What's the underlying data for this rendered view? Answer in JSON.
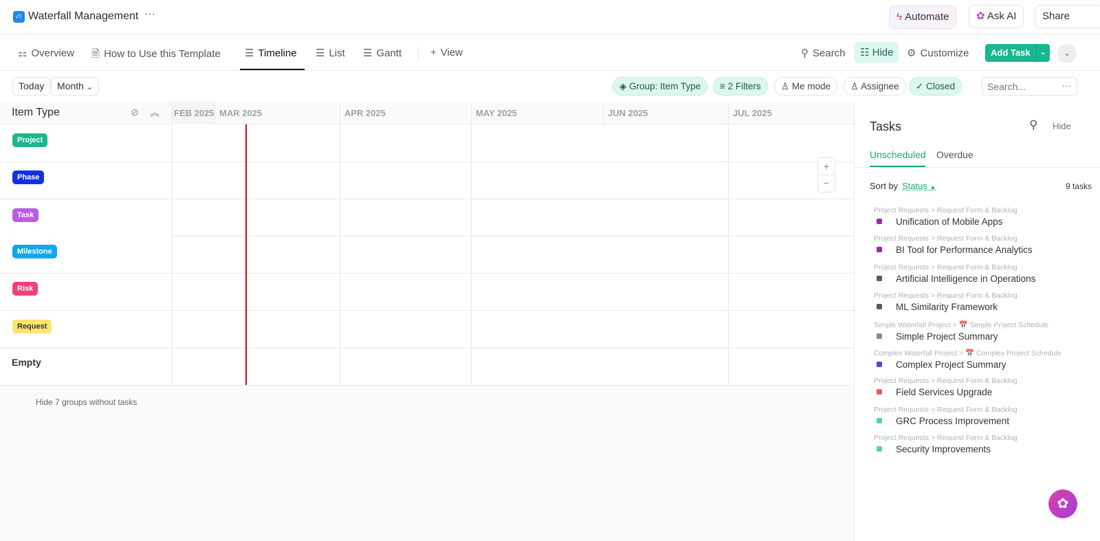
{
  "header": {
    "title": "Waterfall Management",
    "more": "···",
    "automate": "Automate",
    "ask_ai": "Ask AI",
    "share": "Share"
  },
  "tabs": [
    {
      "label": "Overview",
      "icon": "⚏"
    },
    {
      "label": "How to Use this Template",
      "icon": "🗎"
    },
    {
      "label": "Timeline",
      "icon": "☰"
    },
    {
      "label": "List",
      "icon": "☰"
    },
    {
      "label": "Gantt",
      "icon": "☰"
    },
    {
      "label": "View",
      "icon": "+"
    }
  ],
  "actions": {
    "search": "Search",
    "hide": "Hide",
    "customize": "Customize",
    "add_task": "Add Task"
  },
  "toolbar": {
    "today": "Today",
    "month": "Month",
    "group": "Group: Item Type",
    "filters": "2 Filters",
    "me_mode": "Me mode",
    "assignee": "Assignee",
    "closed": "Closed",
    "search_placeholder": "Search...",
    "more": "···"
  },
  "timeline": {
    "column_header": "Item Type",
    "months": [
      "FEB 2025",
      "MAR 2025",
      "APR 2025",
      "MAY 2025",
      "JUN 2025",
      "JUL 2025"
    ],
    "groups": [
      {
        "label": "Project",
        "color": "#1fb58f"
      },
      {
        "label": "Phase",
        "color": "#1330e0"
      },
      {
        "label": "Task",
        "color": "#b85ce6"
      },
      {
        "label": "Milestone",
        "color": "#13a6ee"
      },
      {
        "label": "Risk",
        "color": "#f23f7b"
      },
      {
        "label": "Request",
        "color": "#fde56a"
      },
      {
        "label": "Empty"
      }
    ],
    "hide_groups": "Hide 7 groups without tasks",
    "today_color": "#d0021b"
  },
  "panel": {
    "title": "Tasks",
    "hide": "Hide",
    "tab_unscheduled": "Unscheduled",
    "tab_overdue": "Overdue",
    "sort_by": "Sort by",
    "sort_field": "Status",
    "count": "9 tasks",
    "tasks": [
      {
        "crumb": "Project Requests > Request Form & Backlog",
        "name": "Unification of Mobile Apps",
        "color": "#9c27b0"
      },
      {
        "crumb": "Project Requests > Request Form & Backlog",
        "name": "BI Tool for Performance Analytics",
        "color": "#9c27b0"
      },
      {
        "crumb": "Project Requests > Request Form & Backlog",
        "name": "Artificial Intelligence in Operations",
        "color": "#5a5a5a"
      },
      {
        "crumb": "Project Requests > Request Form & Backlog",
        "name": "ML Similarity Framework",
        "color": "#5a5a5a"
      },
      {
        "crumb": "Simple Waterfall Project > 📅 Simple Project Schedule",
        "name": "Simple Project Summary",
        "color": "#8a8a8a"
      },
      {
        "crumb": "Complex Waterfall Project > 📅 Complex Project Schedule",
        "name": "Complex Project Summary",
        "color": "#5b3fd6"
      },
      {
        "crumb": "Project Requests > Request Form & Backlog",
        "name": "Field Services Upgrade",
        "color": "#e0605e"
      },
      {
        "crumb": "Project Requests > Request Form & Backlog",
        "name": "GRC Process Improvement",
        "color": "#4dd4b0"
      },
      {
        "crumb": "Project Requests > Request Form & Backlog",
        "name": "Security Improvements",
        "color": "#4dd4b0"
      }
    ]
  }
}
